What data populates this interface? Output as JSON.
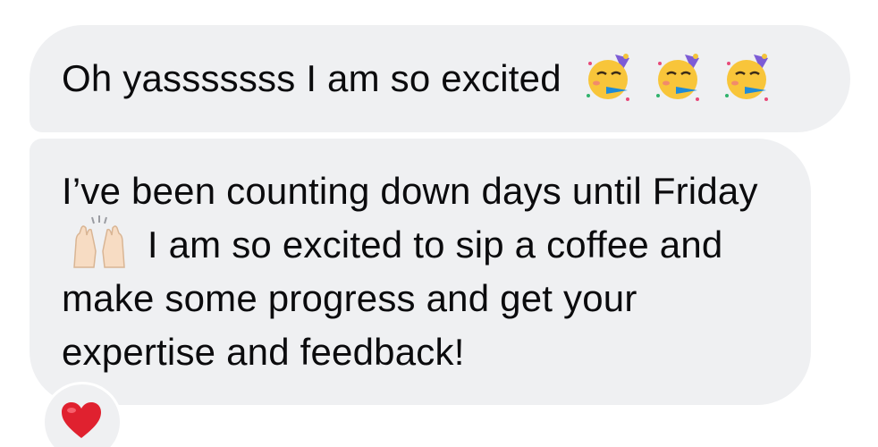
{
  "messages": [
    {
      "text": "Oh yasssssss I am so excited",
      "emojis": [
        "partying-face-icon",
        "partying-face-icon",
        "partying-face-icon"
      ]
    },
    {
      "text_before": "I’ve been counting down days until Friday",
      "emoji": "raising-hands-icon",
      "text_after": "I am so excited to sip a coffee and make some progress and get your expertise and feedback!",
      "reaction": "heart-icon"
    }
  ],
  "colors": {
    "bubble": "#eff0f2",
    "text": "#0b0b0d",
    "heart": "#e0212f",
    "party_face": "#f8c53a"
  }
}
